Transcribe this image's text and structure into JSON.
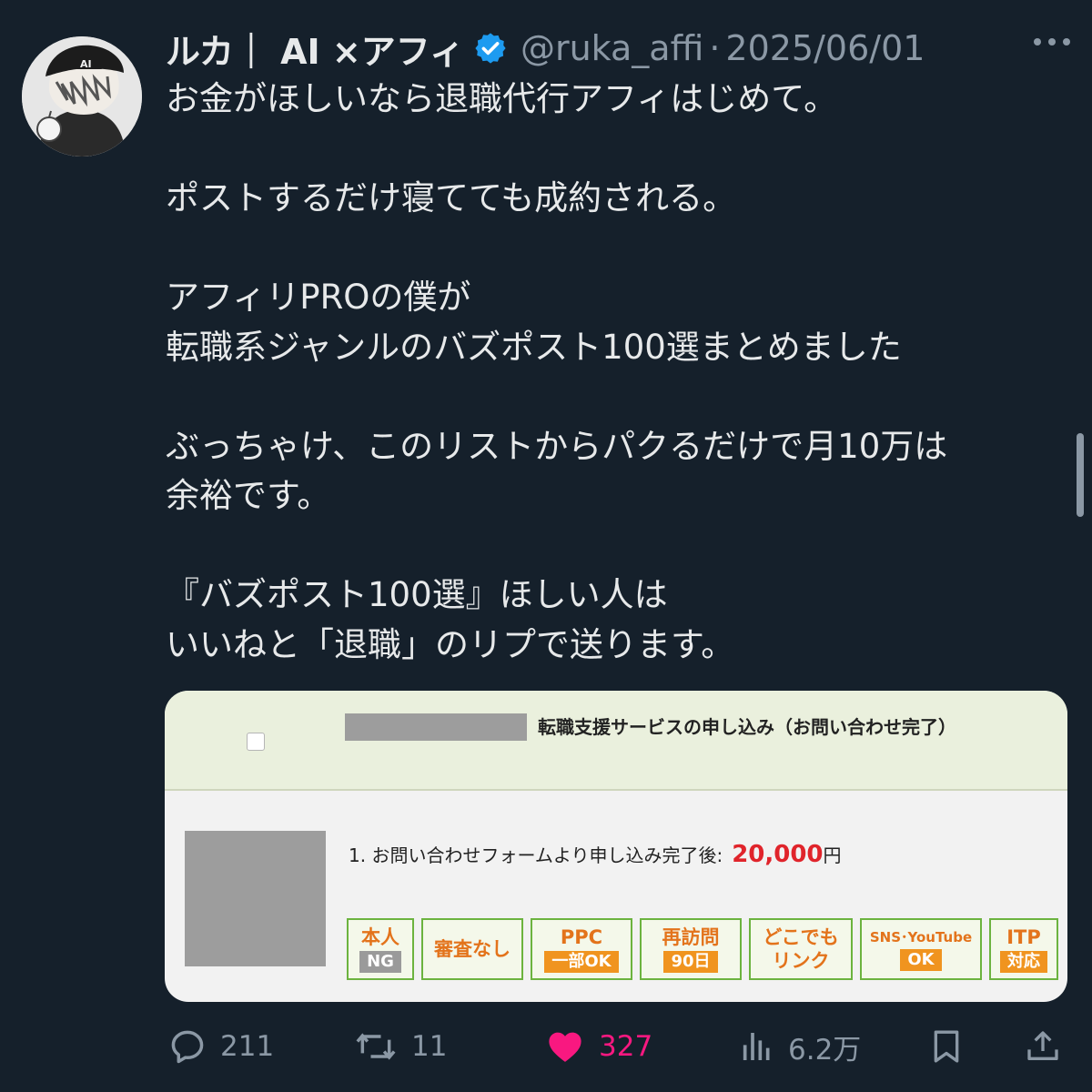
{
  "post": {
    "author_name": "ルカ｜ AI ×アフィ",
    "handle": "@ruka_affi",
    "separator": "·",
    "date": "2025/06/01",
    "text": "お金がほしいなら退職代行アフィはじめて。\n\nポストするだけ寝てても成約される。\n\nアフィリPROの僕が\n転職系ジャンルのバズポスト100選まとめました\n\nぶっちゃけ、このリストからパクるだけで月10万は\n余裕です。\n\n『バズポスト100選』ほしい人は\nいいねと「退職」のリプで送ります。",
    "avatar_label": "AI"
  },
  "card": {
    "title": "転職支援サービスの申し込み（お問い合わせ完了）",
    "line_label": "1. お問い合わせフォームより申し込み完了後:",
    "amount": "20,000",
    "currency": "円",
    "badges": [
      {
        "top": "本人",
        "bottom": "NG"
      },
      {
        "single": "審査なし"
      },
      {
        "top": "PPC",
        "bottom": "一部OK"
      },
      {
        "top": "再訪問",
        "bottom": "90日"
      },
      {
        "top": "どこでも",
        "top2": "リンク"
      },
      {
        "top": "SNS･YouTube",
        "bottom": "OK"
      },
      {
        "top": "ITP",
        "bottom": "対応"
      }
    ]
  },
  "actions": {
    "replies": "211",
    "reposts": "11",
    "likes": "327",
    "views": "6.2万"
  },
  "colors": {
    "background": "#15202b",
    "text": "#e7e9ea",
    "muted": "#8b98a5",
    "verified": "#1d9bf0",
    "like": "#f91880"
  }
}
